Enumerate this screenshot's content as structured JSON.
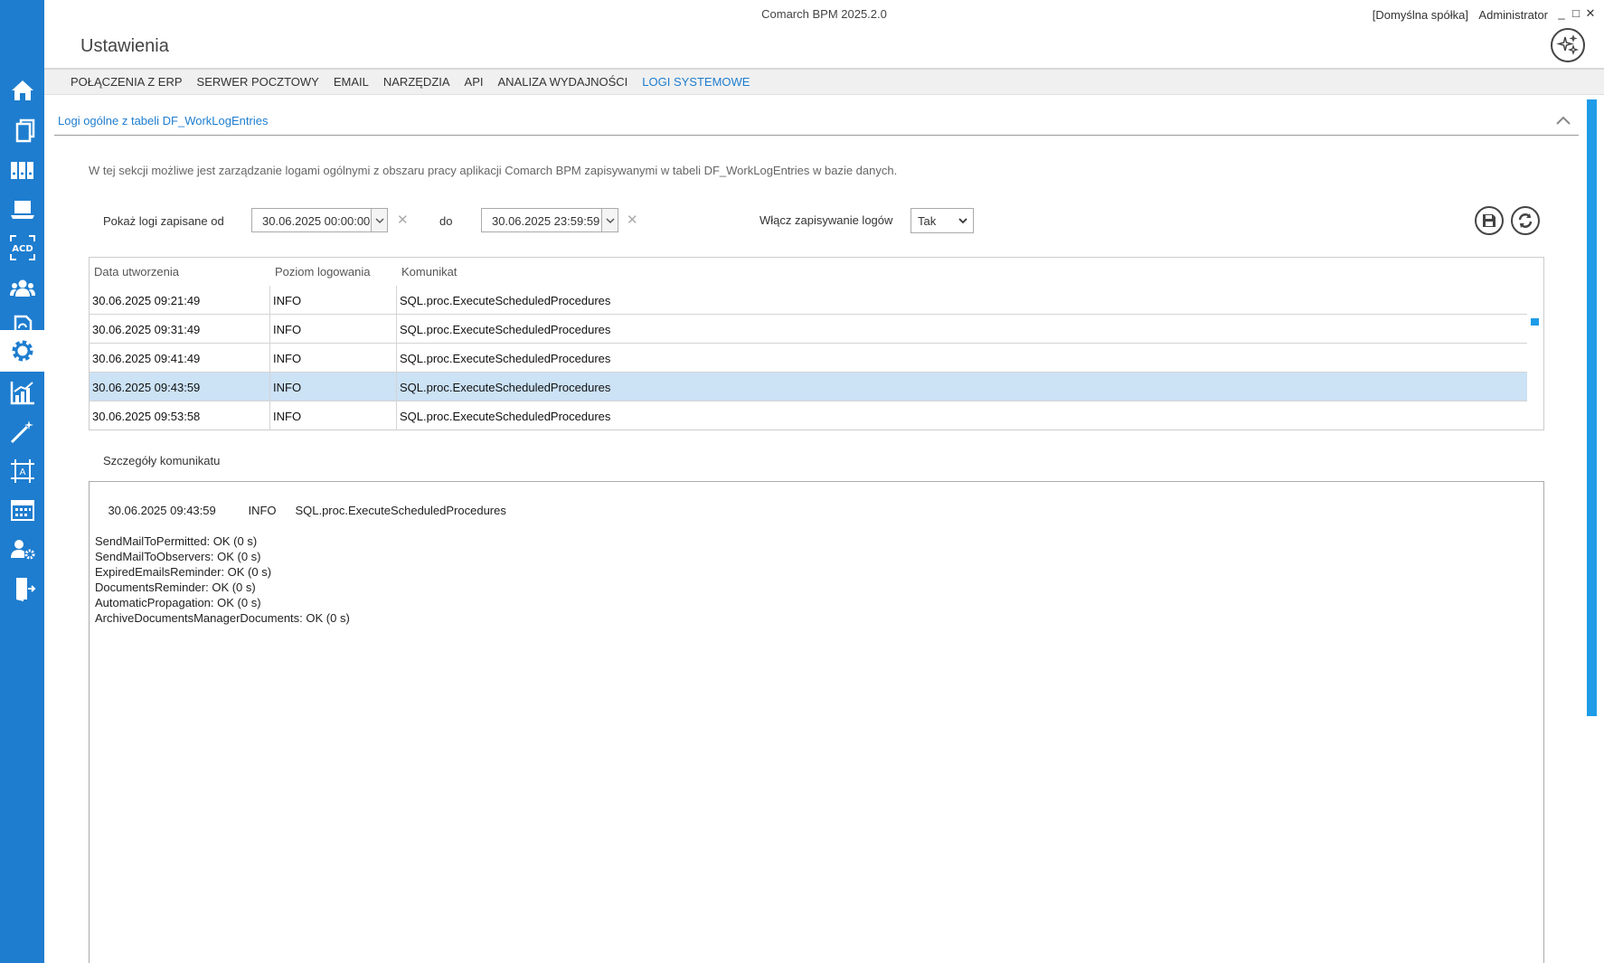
{
  "titlebar": {
    "app_title": "Comarch BPM 2025.2.0",
    "company": "[Domyślna spółka]",
    "user": "Administrator",
    "minimize": "_",
    "maximize": "□",
    "close": "✕"
  },
  "page_title": "Ustawienia",
  "tabs": [
    {
      "label": "POŁĄCZENIA Z ERP"
    },
    {
      "label": "SERWER POCZTOWY"
    },
    {
      "label": "EMAIL"
    },
    {
      "label": "NARZĘDZIA"
    },
    {
      "label": "API"
    },
    {
      "label": "ANALIZA WYDAJNOŚCI"
    },
    {
      "label": "LOGI SYSTEMOWE",
      "active": true
    }
  ],
  "section": {
    "title": "Logi ogólne z tabeli DF_WorkLogEntries",
    "description": "W tej sekcji możliwe jest zarządzanie logami ogólnymi z obszaru pracy aplikacji Comarch BPM zapisywanymi w tabeli DF_WorkLogEntries w bazie danych."
  },
  "filters": {
    "from_label": "Pokaż logi zapisane od",
    "from_value": "30.06.2025 00:00:00",
    "to_label": "do",
    "to_value": "30.06.2025 23:59:59",
    "clear_symbol": "✕",
    "enable_label": "Włącz zapisywanie logów",
    "enable_value": "Tak"
  },
  "grid": {
    "columns": [
      "Data utworzenia",
      "Poziom logowania",
      "Komunikat"
    ],
    "rows": [
      {
        "date": "30.06.2025 09:21:49",
        "level": "INFO",
        "message": "SQL.proc.ExecuteScheduledProcedures"
      },
      {
        "date": "30.06.2025 09:31:49",
        "level": "INFO",
        "message": "SQL.proc.ExecuteScheduledProcedures"
      },
      {
        "date": "30.06.2025 09:41:49",
        "level": "INFO",
        "message": "SQL.proc.ExecuteScheduledProcedures"
      },
      {
        "date": "30.06.2025 09:43:59",
        "level": "INFO",
        "message": "SQL.proc.ExecuteScheduledProcedures",
        "selected": true
      },
      {
        "date": "30.06.2025 09:53:58",
        "level": "INFO",
        "message": "SQL.proc.ExecuteScheduledProcedures"
      }
    ]
  },
  "details": {
    "label": "Szczegóły komunikatu",
    "head_date": "30.06.2025 09:43:59",
    "head_level": "INFO",
    "head_message": "SQL.proc.ExecuteScheduledProcedures",
    "lines": [
      "SendMailToPermitted: OK (0 s)",
      "SendMailToObservers: OK (0 s)",
      "ExpiredEmailsReminder: OK (0 s)",
      "DocumentsReminder: OK (0 s)",
      "AutomaticPropagation: OK (0 s)",
      "ArchiveDocumentsManagerDocuments: OK (0 s)"
    ]
  },
  "sidebar": {
    "items": [
      {
        "icon": "home-icon"
      },
      {
        "icon": "documents-icon"
      },
      {
        "icon": "binders-icon"
      },
      {
        "icon": "laptop-icon"
      },
      {
        "icon": "acd-icon",
        "text": "ACD"
      },
      {
        "icon": "users-icon"
      },
      {
        "icon": "document-sync-icon"
      },
      {
        "icon": "gear-icon",
        "active": true
      },
      {
        "icon": "chart-icon"
      },
      {
        "icon": "magic-wand-icon"
      },
      {
        "icon": "template-icon",
        "text": "A"
      },
      {
        "icon": "calendar-icon"
      },
      {
        "icon": "user-settings-icon"
      },
      {
        "icon": "logout-icon"
      }
    ]
  },
  "colors": {
    "accent": "#1e7dcf",
    "selected_row": "#cce2f5",
    "scrollbar": "#1e9ce8"
  }
}
